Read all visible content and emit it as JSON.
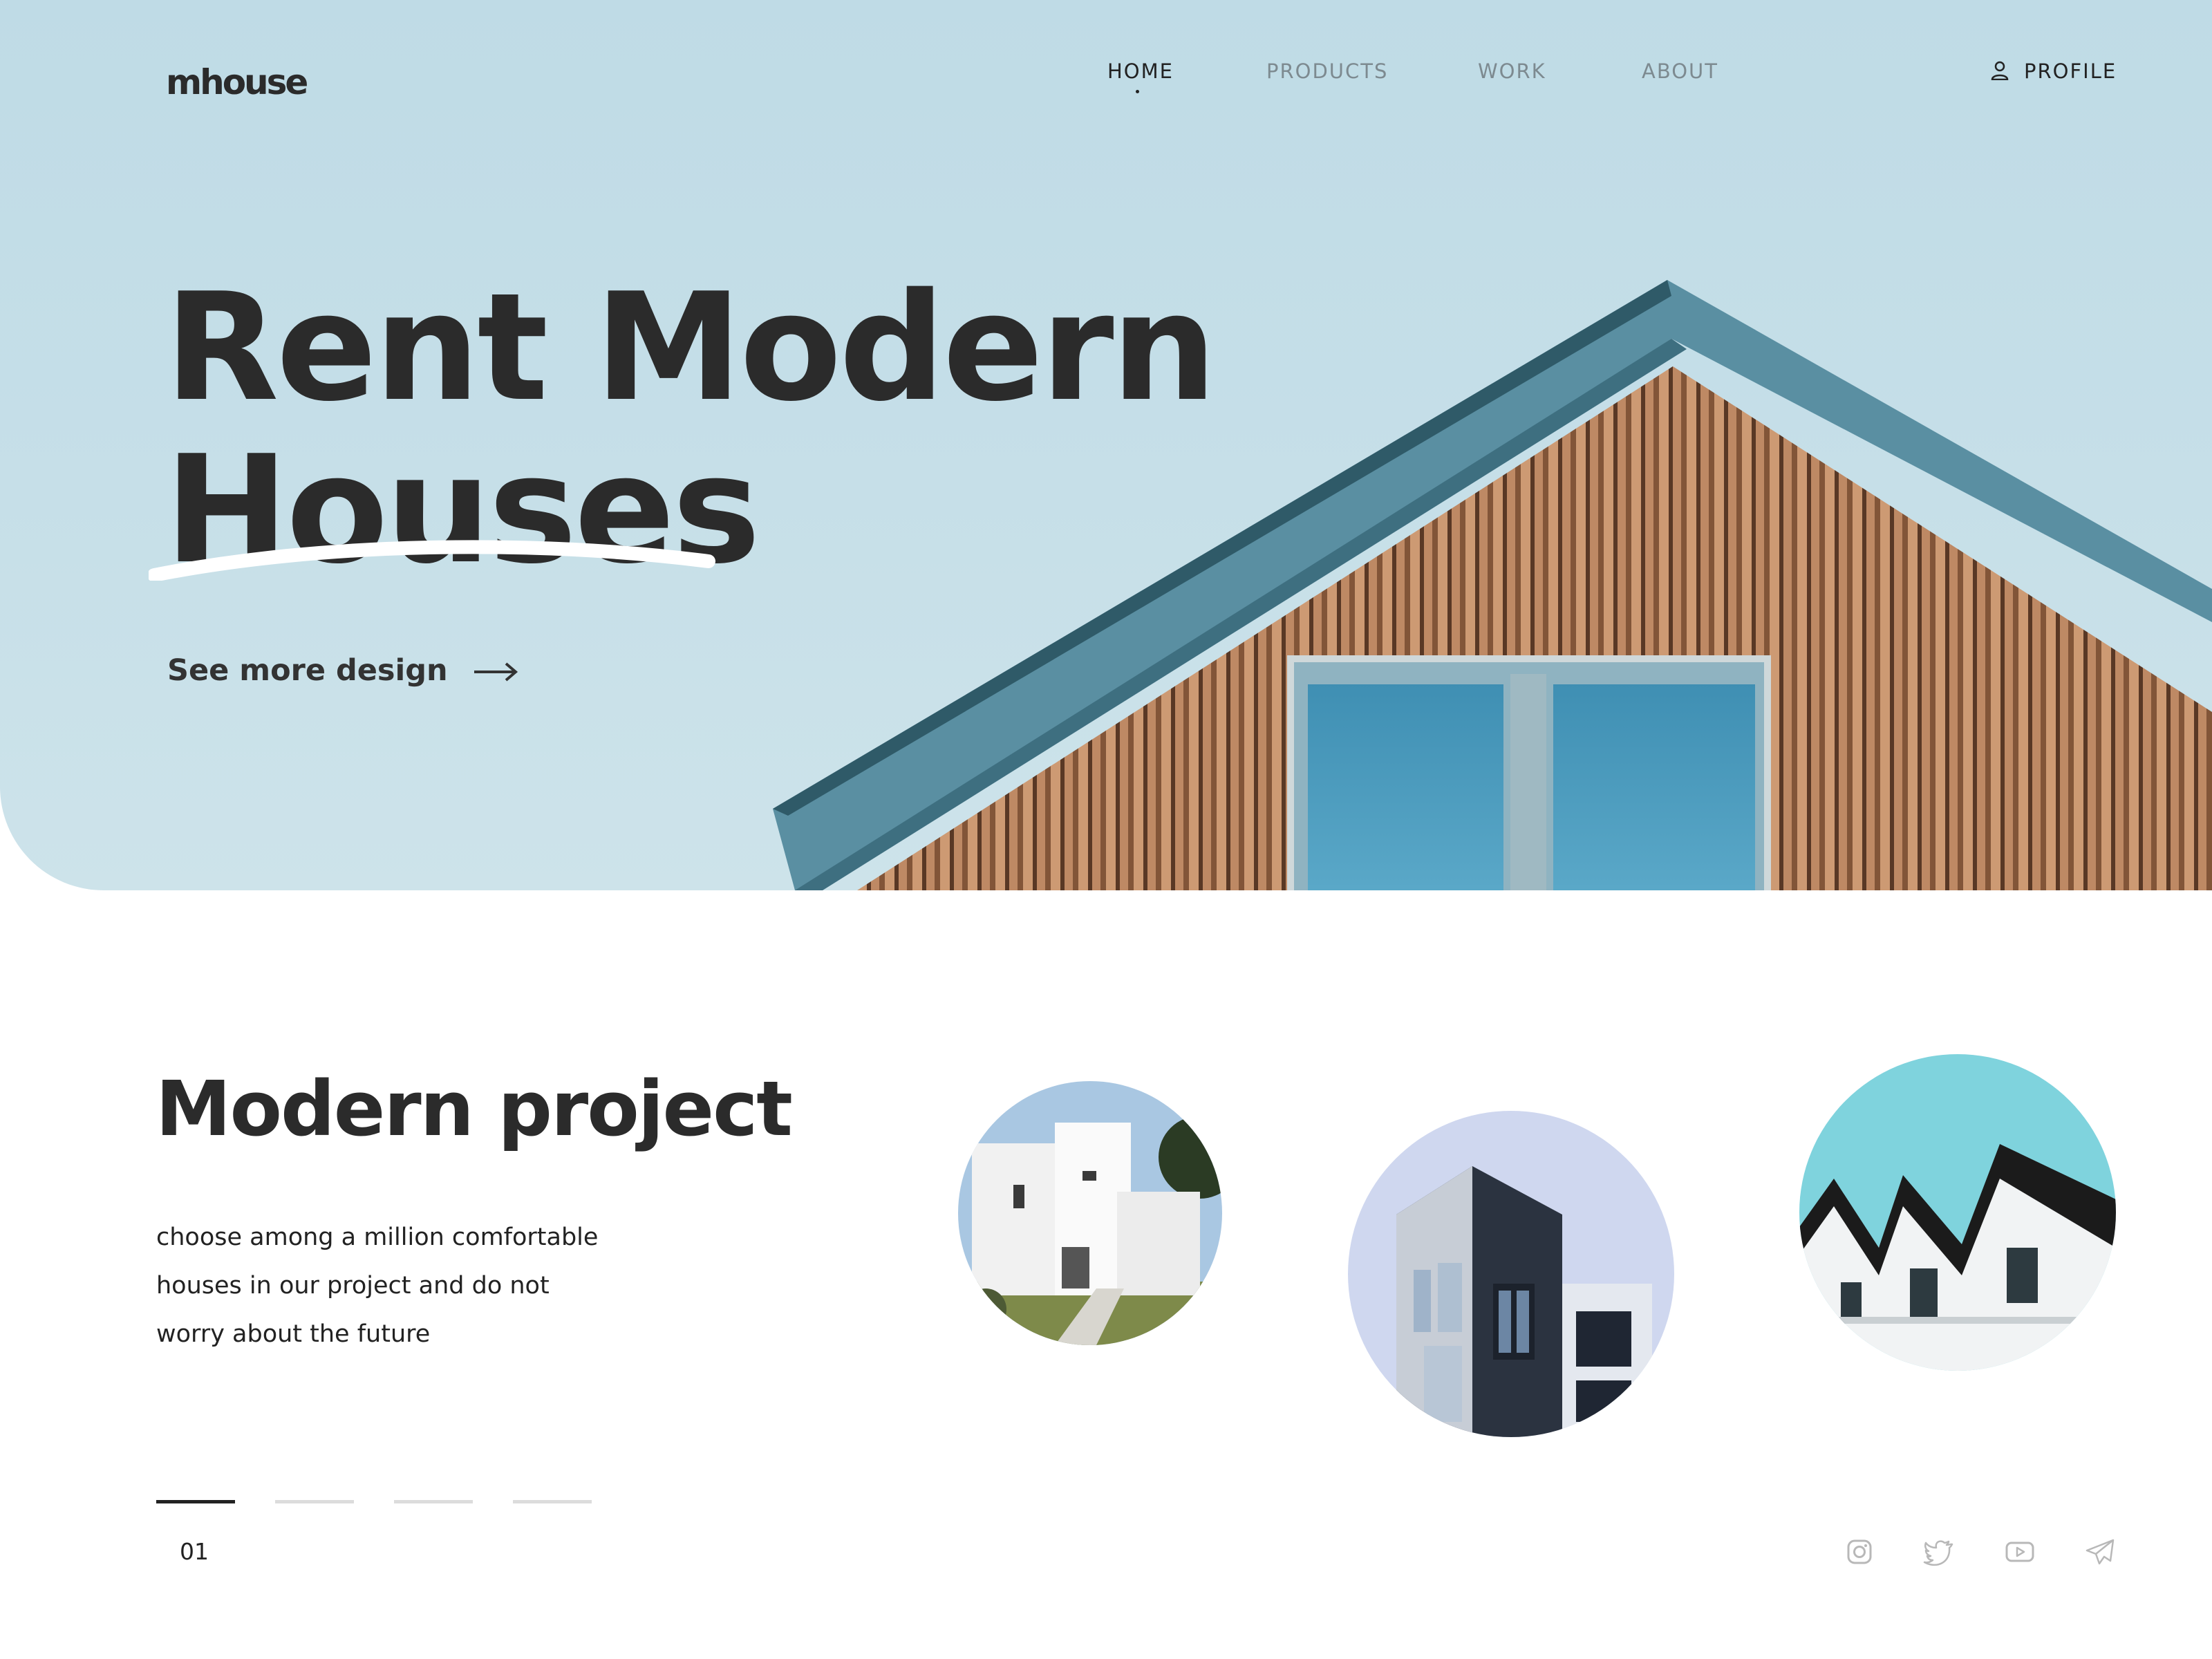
{
  "brand": {
    "logo": "mhouse"
  },
  "nav": {
    "items": [
      {
        "label": "HOME",
        "active": true
      },
      {
        "label": "PRODUCTS",
        "active": false
      },
      {
        "label": "WORK",
        "active": false
      },
      {
        "label": "ABOUT",
        "active": false
      }
    ],
    "profile_label": "PROFILE"
  },
  "hero": {
    "title_line1": "Rent Modern",
    "title_line2": "Houses",
    "cta_label": "See more design"
  },
  "project": {
    "title": "Modern project",
    "description_lines": [
      "choose among a million comfortable",
      "houses in our project and do not",
      "worry about the future"
    ]
  },
  "slider": {
    "bars": 4,
    "active_index": 0,
    "counter": "01"
  },
  "social": [
    "instagram-icon",
    "twitter-icon",
    "youtube-icon",
    "telegram-icon"
  ],
  "colors": {
    "sky": "#c4dde7",
    "text": "#2b2b2b",
    "muted_nav": "#7d8a90",
    "roof": "#4f8293",
    "wood": "#c0875e"
  }
}
